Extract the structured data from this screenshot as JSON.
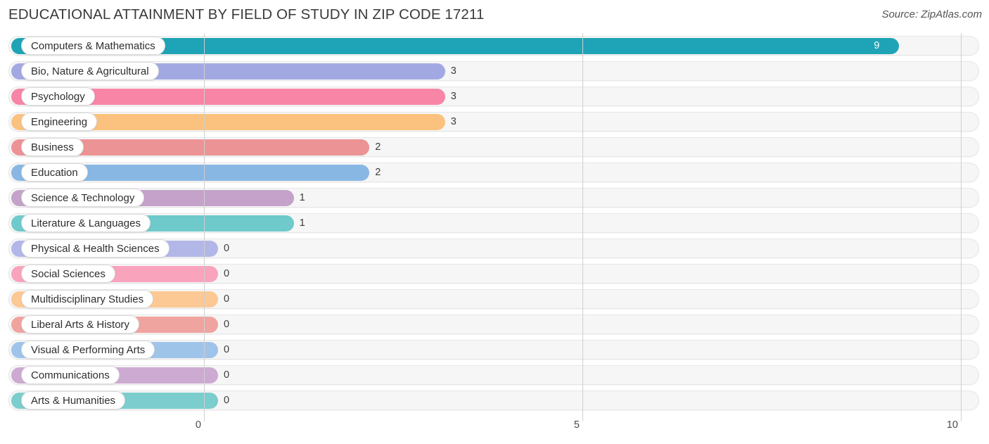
{
  "header": {
    "title": "EDUCATIONAL ATTAINMENT BY FIELD OF STUDY IN ZIP CODE 17211",
    "source": "Source: ZipAtlas.com"
  },
  "chart_data": {
    "type": "bar",
    "orientation": "horizontal",
    "title": "EDUCATIONAL ATTAINMENT BY FIELD OF STUDY IN ZIP CODE 17211",
    "xlabel": "",
    "ylabel": "",
    "xlim": [
      0,
      10
    ],
    "xticks": [
      "0",
      "5",
      "10"
    ],
    "xtick_values": [
      0,
      5,
      10
    ],
    "grid": true,
    "legend": false,
    "categories": [
      "Computers & Mathematics",
      "Bio, Nature & Agricultural",
      "Psychology",
      "Engineering",
      "Business",
      "Education",
      "Science & Technology",
      "Literature & Languages",
      "Physical & Health Sciences",
      "Social Sciences",
      "Multidisciplinary Studies",
      "Liberal Arts & History",
      "Visual & Performing Arts",
      "Communications",
      "Arts & Humanities"
    ],
    "values": [
      9,
      3,
      3,
      3,
      2,
      2,
      1,
      1,
      0,
      0,
      0,
      0,
      0,
      0,
      0
    ],
    "value_labels": [
      "9",
      "3",
      "3",
      "3",
      "2",
      "2",
      "1",
      "1",
      "0",
      "0",
      "0",
      "0",
      "0",
      "0",
      "0"
    ],
    "colors": [
      "#1fa3b6",
      "#a2a9e2",
      "#f885a5",
      "#fbc27f",
      "#ec9395",
      "#89b7e4",
      "#c4a2c9",
      "#6fcacb",
      "#b2b7e8",
      "#f9a3bd",
      "#fcc893",
      "#efa49f",
      "#9fc4ea",
      "#cdaad2",
      "#7ccdcd"
    ]
  }
}
